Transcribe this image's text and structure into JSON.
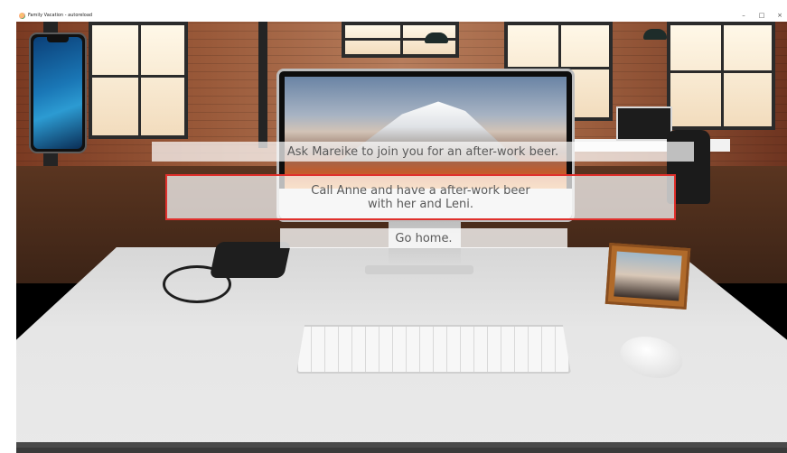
{
  "window": {
    "title": "Family Vacation - autoreload",
    "minimize_icon": "minimize-icon",
    "maximize_icon": "maximize-icon",
    "close_icon": "close-icon"
  },
  "choices": [
    {
      "label": "Ask Mareike to join you for an after-work beer."
    },
    {
      "label": "Call Anne and have a after-work beer with her and Leni.",
      "selected": true
    },
    {
      "label": "Go home."
    }
  ],
  "colors": {
    "highlight_border": "#e0302c",
    "choice_text": "#5a5a5a",
    "choice_background": "rgba(255,255,255,0.72)"
  },
  "icons": {
    "app_icon": "app-icon",
    "smartphone": "smartphone-icon"
  }
}
